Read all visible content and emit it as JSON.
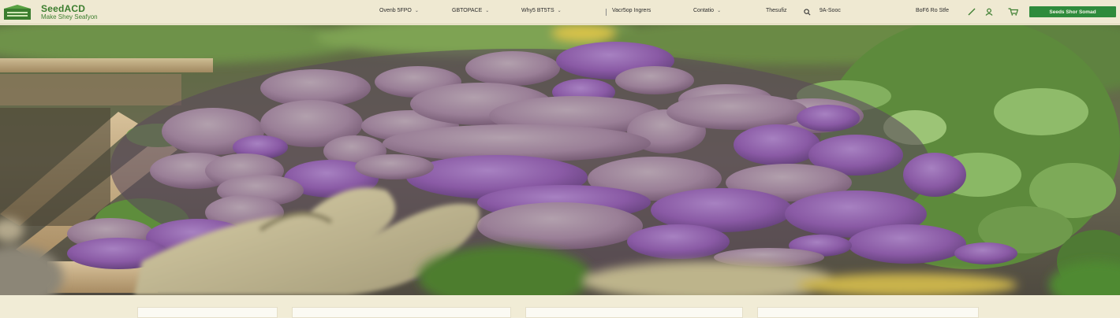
{
  "brand": {
    "name": "SeedACD",
    "tagline": "Make Shey Seafyon",
    "accent": "#3b7d2e"
  },
  "nav": {
    "items": [
      {
        "label": "Ovenb 5FPO",
        "has_dropdown": true
      },
      {
        "label": "GBTOPACE",
        "has_dropdown": true
      },
      {
        "label": "Why5 BT5TS",
        "has_dropdown": true
      },
      {
        "label": "Vacr5op Ingrers",
        "has_dropdown": false
      },
      {
        "label": "Contatio",
        "has_dropdown": true
      }
    ],
    "search_label": "Thesufiz",
    "search_icon": "search-icon",
    "account_label": "9A-Sooc",
    "cart_label": "BoF6 Ro Stfe",
    "edit_icon": "pencil-icon",
    "user_icon": "user-icon",
    "cart_icon": "cart-icon",
    "cta_label": "Seeds Shor Somad"
  },
  "hero": {
    "image": "purple-potatoes-harvest-crate",
    "colors": {
      "potato_purple": "#8f5aa6",
      "potato_skin": "#a08c9a",
      "leaf_green": "#6c9a4a",
      "crate_wood": "#c9ad82"
    }
  },
  "cards": {
    "count": 4
  }
}
